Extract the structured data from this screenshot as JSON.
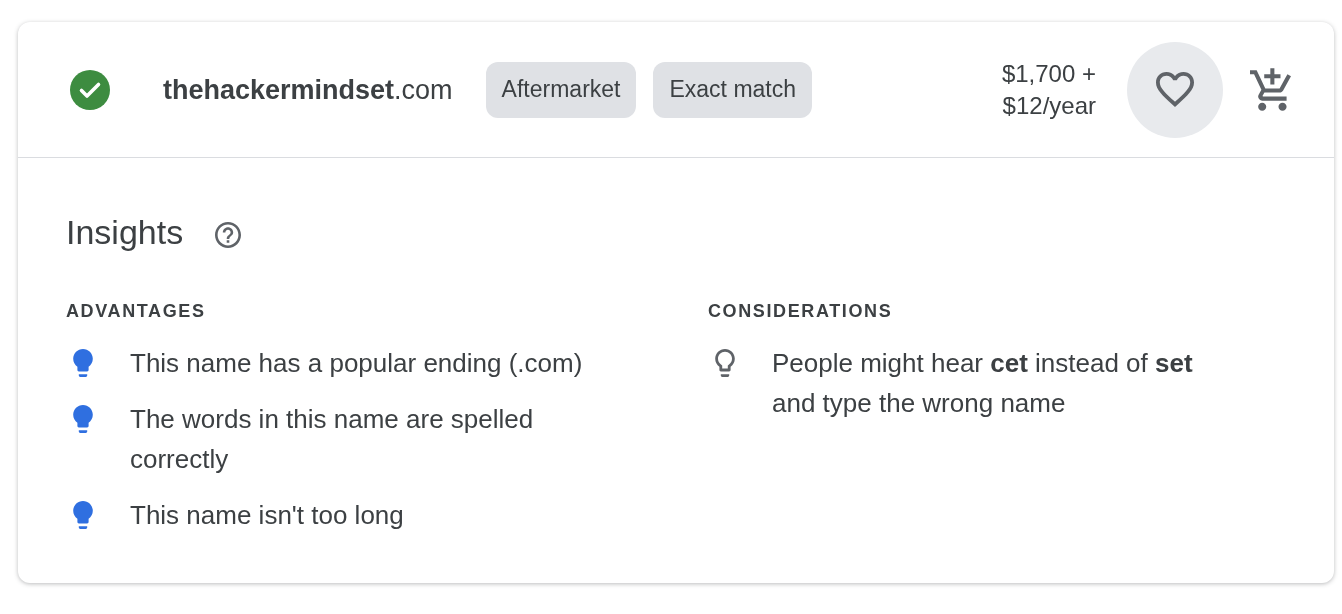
{
  "result": {
    "available": true,
    "domain": "**thehackermindset**.com",
    "tags": [
      "Aftermarket",
      "Exact match"
    ],
    "price": "$1,700 + $12/year",
    "favorite": false
  },
  "insights": {
    "title": "Insights",
    "sections": [
      {
        "kind": "advantages",
        "heading": "ADVANTAGES",
        "items": [
          "This name has a popular ending (.com)",
          "The words in this name are spelled correctly",
          "This name isn't too long"
        ]
      },
      {
        "kind": "considerations",
        "heading": "CONSIDERATIONS",
        "items": [
          "People might hear **cet** instead of **set** and type the wrong name"
        ]
      }
    ]
  }
}
